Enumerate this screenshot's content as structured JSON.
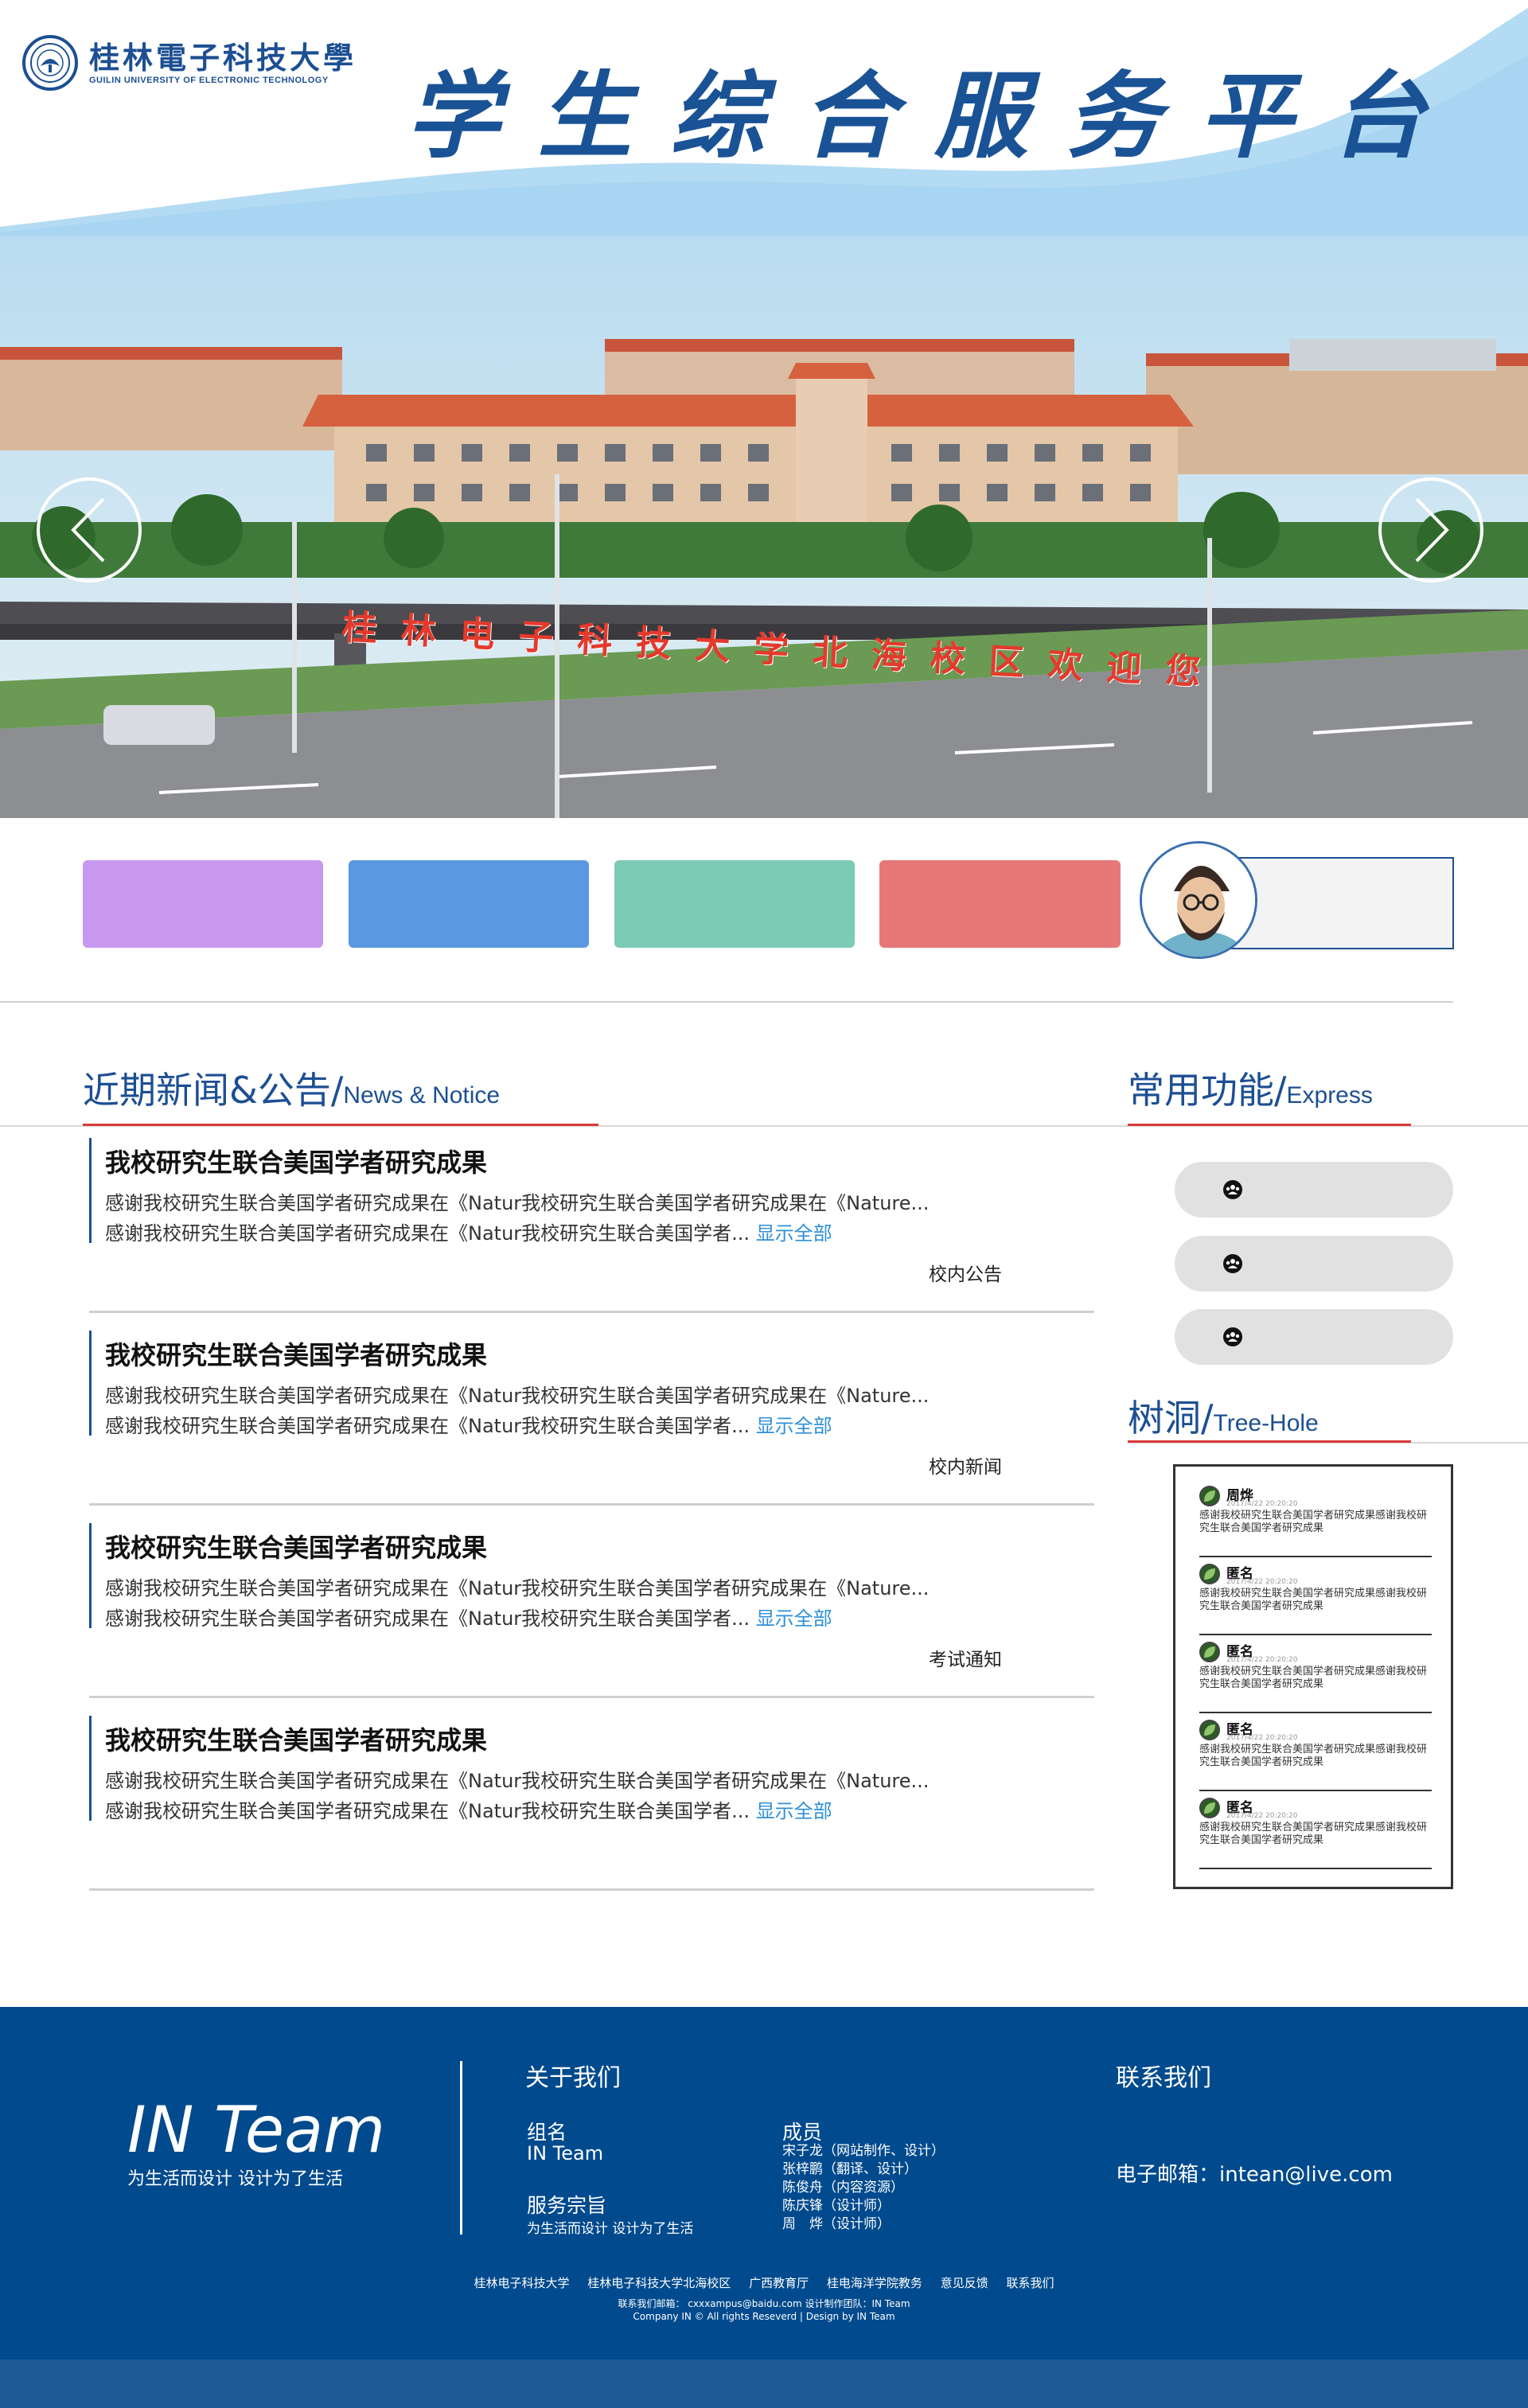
{
  "header": {
    "logo_cn": "桂林電子科技大學",
    "logo_en": "GUILIN UNIVERSITY OF ELECTRONIC TECHNOLOGY",
    "site_title": "学生综合服务平台"
  },
  "banner": {
    "caption": "桂林电子科技大学北海校区欢迎您",
    "prev_icon": "chevron-left-icon",
    "next_icon": "chevron-right-icon"
  },
  "quick_tiles": [
    {
      "color": "#c898ef"
    },
    {
      "color": "#5a98e2"
    },
    {
      "color": "#7bcbb5"
    },
    {
      "color": "#e87878"
    }
  ],
  "news_section": {
    "title_cn": "近期新闻&公告/",
    "title_en": "News & Notice",
    "show_all": "显示全部",
    "items": [
      {
        "title": "我校研究生联合美国学者研究成果",
        "line1": "感谢我校研究生联合美国学者研究成果在《Natur我校研究生联合美国学者研究成果在《Nature...",
        "line2": "感谢我校研究生联合美国学者研究成果在《Natur我校研究生联合美国学者...",
        "category": "校内公告"
      },
      {
        "title": "我校研究生联合美国学者研究成果",
        "line1": "感谢我校研究生联合美国学者研究成果在《Natur我校研究生联合美国学者研究成果在《Nature...",
        "line2": "感谢我校研究生联合美国学者研究成果在《Natur我校研究生联合美国学者...",
        "category": "校内新闻"
      },
      {
        "title": "我校研究生联合美国学者研究成果",
        "line1": "感谢我校研究生联合美国学者研究成果在《Natur我校研究生联合美国学者研究成果在《Nature...",
        "line2": "感谢我校研究生联合美国学者研究成果在《Natur我校研究生联合美国学者...",
        "category": "考试通知"
      },
      {
        "title": "我校研究生联合美国学者研究成果",
        "line1": "感谢我校研究生联合美国学者研究成果在《Natur我校研究生联合美国学者研究成果在《Nature...",
        "line2": "感谢我校研究生联合美国学者研究成果在《Natur我校研究生联合美国学者...",
        "category": ""
      }
    ]
  },
  "express": {
    "title_cn": "常用功能/",
    "title_en": "Express",
    "pill_icon": "group-icon",
    "count": 3
  },
  "treehole": {
    "title_cn": "树洞/",
    "title_en": "Tree-Hole",
    "posts": [
      {
        "name": "周烨",
        "time": "2017/4/22 20:20:20",
        "text": "感谢我校研究生联合美国学者研究成果感谢我校研究生联合美国学者研究成果"
      },
      {
        "name": "匿名",
        "time": "2017/4/22 20:20:20",
        "text": "感谢我校研究生联合美国学者研究成果感谢我校研究生联合美国学者研究成果"
      },
      {
        "name": "匿名",
        "time": "2017/4/22 20:20:20",
        "text": "感谢我校研究生联合美国学者研究成果感谢我校研究生联合美国学者研究成果"
      },
      {
        "name": "匿名",
        "time": "2017/4/22 20:20:20",
        "text": "感谢我校研究生联合美国学者研究成果感谢我校研究生联合美国学者研究成果"
      },
      {
        "name": "匿名",
        "time": "2017/4/22 20:20:20",
        "text": "感谢我校研究生联合美国学者研究成果感谢我校研究生联合美国学者研究成果"
      }
    ]
  },
  "footer": {
    "team_name": "IN Team",
    "team_slogan": "为生活而设计 设计为了生活",
    "about_title": "关于我们",
    "group_label": "组名",
    "group_value": "IN Team",
    "purpose_label": "服务宗旨",
    "purpose_value": "为生活而设计 设计为了生活",
    "members_label": "成员",
    "members": [
      "宋子龙（网站制作、设计）",
      "张梓鹏（翻译、设计）",
      "陈俊舟（内容资源）",
      "陈庆锋（设计师）",
      "周　烨（设计师）"
    ],
    "contact_title": "联系我们",
    "email_line": "电子邮箱：intean@live.com",
    "links": [
      "桂林电子科技大学",
      "桂林电子科技大学北海校区",
      "广西教育厅",
      "桂电海洋学院教务",
      "意见反馈",
      "联系我们"
    ],
    "contact_small": "联系我们邮箱： cxxxampus@baidu.com   设计制作团队：IN Team",
    "copyright": "Company IN © All rights Reseverd | Design by IN Team"
  },
  "colors": {
    "brand_blue": "#1c4f93",
    "footer_blue": "#004a8d",
    "accent_red": "#d93a3a",
    "link_blue": "#2f8fd8"
  }
}
